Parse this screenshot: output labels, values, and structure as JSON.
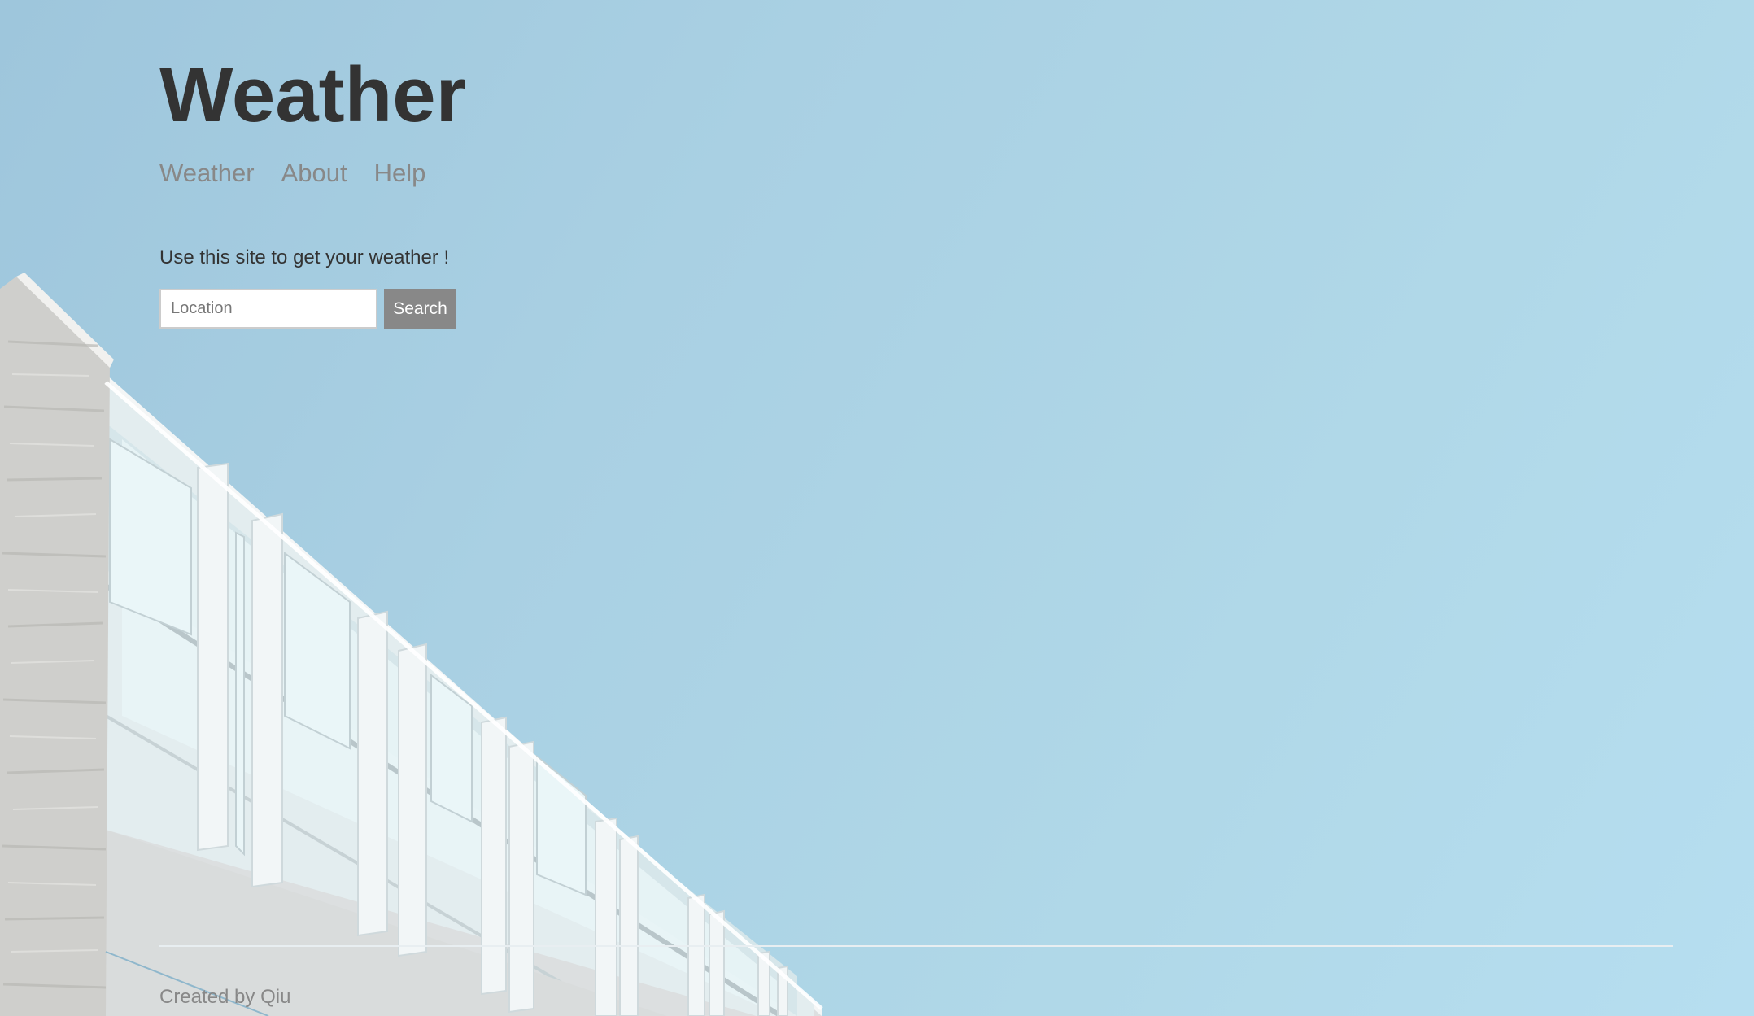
{
  "header": {
    "title": "Weather"
  },
  "nav": {
    "items": [
      {
        "label": "Weather"
      },
      {
        "label": "About"
      },
      {
        "label": "Help"
      }
    ]
  },
  "main": {
    "intro": "Use this site to get your weather !",
    "search": {
      "placeholder": "Location",
      "value": "",
      "button_label": "Search"
    }
  },
  "footer": {
    "text": "Created by Qiu"
  },
  "colors": {
    "sky": "#a9d0e3",
    "title_text": "#333333",
    "nav_text": "#888888",
    "button_bg": "#888888"
  }
}
